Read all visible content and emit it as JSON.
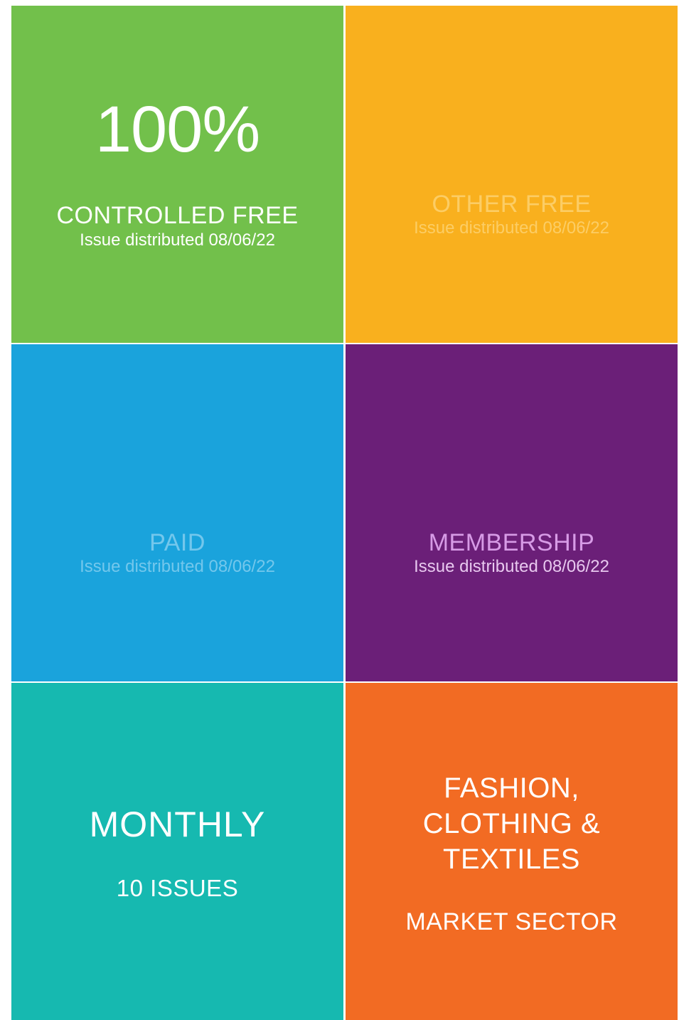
{
  "tiles": {
    "controlled_free": {
      "percent": "100%",
      "label": "CONTROLLED FREE",
      "date": "Issue distributed 08/06/22",
      "color": "#72c04b"
    },
    "other_free": {
      "label": "OTHER FREE",
      "date": "Issue distributed 08/06/22",
      "color": "#f9b01e"
    },
    "paid": {
      "label": "PAID",
      "date": "Issue distributed 08/06/22",
      "color": "#1aa3dc"
    },
    "membership": {
      "label": "MEMBERSHIP",
      "date": "Issue distributed 08/06/22",
      "color": "#6b1f78"
    },
    "frequency": {
      "title": "MONTHLY",
      "subtitle": "10 ISSUES",
      "color": "#16b9b0"
    },
    "sector": {
      "title_lines": [
        "FASHION,",
        "CLOTHING &",
        "TEXTILES"
      ],
      "subtitle": "MARKET SECTOR",
      "color": "#f26b23"
    }
  }
}
